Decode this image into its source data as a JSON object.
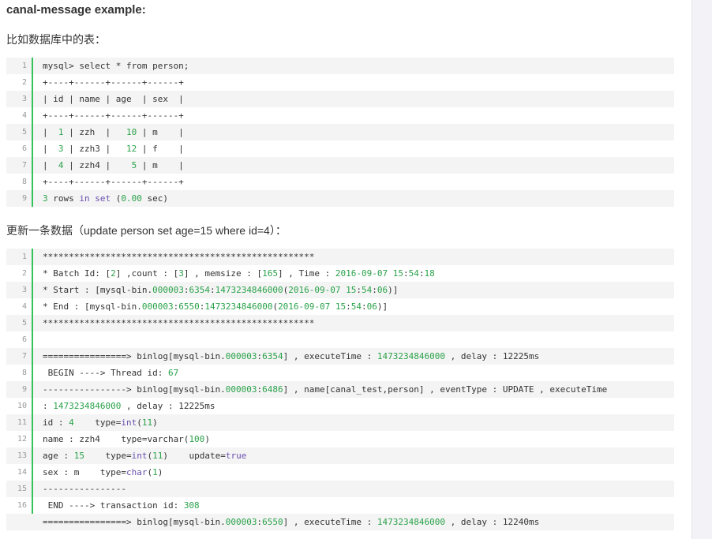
{
  "title": "canal-message example:",
  "para1": "比如数据库中的表：",
  "para2": "更新一条数据（update person set age=15 where id=4）：",
  "block1": [
    {
      "n": "1",
      "parts": [
        {
          "t": "mysql> select * from person;"
        }
      ]
    },
    {
      "n": "2",
      "parts": [
        {
          "t": "+----+------+------+------+"
        }
      ]
    },
    {
      "n": "3",
      "parts": [
        {
          "t": "| id | name | age  | sex  |"
        }
      ]
    },
    {
      "n": "4",
      "parts": [
        {
          "t": "+----+------+------+------+"
        }
      ]
    },
    {
      "n": "5",
      "parts": [
        {
          "t": "|  "
        },
        {
          "t": "1",
          "c": "num"
        },
        {
          "t": " | zzh  |   "
        },
        {
          "t": "10",
          "c": "num"
        },
        {
          "t": " | m    |"
        }
      ]
    },
    {
      "n": "6",
      "parts": [
        {
          "t": "|  "
        },
        {
          "t": "3",
          "c": "num"
        },
        {
          "t": " | zzh3 |   "
        },
        {
          "t": "12",
          "c": "num"
        },
        {
          "t": " | f    |"
        }
      ]
    },
    {
      "n": "7",
      "parts": [
        {
          "t": "|  "
        },
        {
          "t": "4",
          "c": "num"
        },
        {
          "t": " | zzh4 |    "
        },
        {
          "t": "5",
          "c": "num"
        },
        {
          "t": " | m    |"
        }
      ]
    },
    {
      "n": "8",
      "parts": [
        {
          "t": "+----+------+------+------+"
        }
      ]
    },
    {
      "n": "9",
      "parts": [
        {
          "t": "3",
          "c": "num"
        },
        {
          "t": " rows "
        },
        {
          "t": "in",
          "c": "kw"
        },
        {
          "t": " "
        },
        {
          "t": "set",
          "c": "kw"
        },
        {
          "t": " ("
        },
        {
          "t": "0.00",
          "c": "num"
        },
        {
          "t": " sec)"
        }
      ]
    }
  ],
  "block2": [
    {
      "n": "1",
      "parts": [
        {
          "t": "****************************************************"
        }
      ]
    },
    {
      "n": "2",
      "parts": [
        {
          "t": "* Batch Id: ["
        },
        {
          "t": "2",
          "c": "num"
        },
        {
          "t": "] ,count : ["
        },
        {
          "t": "3",
          "c": "num"
        },
        {
          "t": "] , memsize : ["
        },
        {
          "t": "165",
          "c": "num"
        },
        {
          "t": "] , Time : "
        },
        {
          "t": "2016-09-07 15",
          "c": "num"
        },
        {
          "t": ":"
        },
        {
          "t": "54",
          "c": "num"
        },
        {
          "t": ":"
        },
        {
          "t": "18",
          "c": "num"
        }
      ]
    },
    {
      "n": "3",
      "parts": [
        {
          "t": "* Start : [mysql-bin."
        },
        {
          "t": "000003",
          "c": "num"
        },
        {
          "t": ":"
        },
        {
          "t": "6354",
          "c": "num"
        },
        {
          "t": ":"
        },
        {
          "t": "1473234846000",
          "c": "num"
        },
        {
          "t": "("
        },
        {
          "t": "2016-09-07 15",
          "c": "num"
        },
        {
          "t": ":"
        },
        {
          "t": "54",
          "c": "num"
        },
        {
          "t": ":"
        },
        {
          "t": "06",
          "c": "num"
        },
        {
          "t": ")]"
        }
      ]
    },
    {
      "n": "4",
      "parts": [
        {
          "t": "* End : [mysql-bin."
        },
        {
          "t": "000003",
          "c": "num"
        },
        {
          "t": ":"
        },
        {
          "t": "6550",
          "c": "num"
        },
        {
          "t": ":"
        },
        {
          "t": "1473234846000",
          "c": "num"
        },
        {
          "t": "("
        },
        {
          "t": "2016-09-07 15",
          "c": "num"
        },
        {
          "t": ":"
        },
        {
          "t": "54",
          "c": "num"
        },
        {
          "t": ":"
        },
        {
          "t": "06",
          "c": "num"
        },
        {
          "t": ")]"
        }
      ]
    },
    {
      "n": "5",
      "parts": [
        {
          "t": "****************************************************"
        }
      ]
    },
    {
      "n": "6",
      "parts": [
        {
          "t": ""
        }
      ]
    },
    {
      "n": "7",
      "parts": [
        {
          "t": "================> binlog[mysql-bin."
        },
        {
          "t": "000003",
          "c": "num"
        },
        {
          "t": ":"
        },
        {
          "t": "6354",
          "c": "num"
        },
        {
          "t": "] , executeTime : "
        },
        {
          "t": "1473234846000",
          "c": "num"
        },
        {
          "t": " , delay : 12225ms"
        }
      ]
    },
    {
      "n": "8",
      "parts": [
        {
          "t": " BEGIN ----> Thread id: "
        },
        {
          "t": "67",
          "c": "num"
        }
      ]
    },
    {
      "n": "9",
      "parts": [
        {
          "t": "----------------> binlog[mysql-bin."
        },
        {
          "t": "000003",
          "c": "num"
        },
        {
          "t": ":"
        },
        {
          "t": "6486",
          "c": "num"
        },
        {
          "t": "] , name[canal_test,person] , eventType : UPDATE , executeTime"
        }
      ]
    },
    {
      "n": "10",
      "parts": [
        {
          "t": ": "
        },
        {
          "t": "1473234846000",
          "c": "num"
        },
        {
          "t": " , delay : 12225ms"
        }
      ]
    },
    {
      "n": "11",
      "parts": [
        {
          "t": "id : "
        },
        {
          "t": "4",
          "c": "num"
        },
        {
          "t": "    type="
        },
        {
          "t": "int",
          "c": "kw"
        },
        {
          "t": "("
        },
        {
          "t": "11",
          "c": "num"
        },
        {
          "t": ")"
        }
      ]
    },
    {
      "n": "12",
      "parts": [
        {
          "t": "name : zzh4    type=varchar("
        },
        {
          "t": "100",
          "c": "num"
        },
        {
          "t": ")"
        }
      ]
    },
    {
      "n": "13",
      "parts": [
        {
          "t": "age : "
        },
        {
          "t": "15",
          "c": "num"
        },
        {
          "t": "    type="
        },
        {
          "t": "int",
          "c": "kw"
        },
        {
          "t": "("
        },
        {
          "t": "11",
          "c": "num"
        },
        {
          "t": ")    update="
        },
        {
          "t": "true",
          "c": "kw"
        }
      ]
    },
    {
      "n": "14",
      "parts": [
        {
          "t": "sex : m    type="
        },
        {
          "t": "char",
          "c": "kw"
        },
        {
          "t": "("
        },
        {
          "t": "1",
          "c": "num"
        },
        {
          "t": ")"
        }
      ]
    },
    {
      "n": "15",
      "parts": [
        {
          "t": "----------------"
        }
      ]
    },
    {
      "n": "16",
      "parts": [
        {
          "t": " END ----> transaction id: "
        },
        {
          "t": "308",
          "c": "num"
        }
      ]
    },
    {
      "n": "",
      "parts": [
        {
          "t": "================> binlog[mysql-bin."
        },
        {
          "t": "000003",
          "c": "num"
        },
        {
          "t": ":"
        },
        {
          "t": "6550",
          "c": "num"
        },
        {
          "t": "] , executeTime : "
        },
        {
          "t": "1473234846000",
          "c": "num"
        },
        {
          "t": " , delay : 12240ms"
        }
      ]
    }
  ]
}
